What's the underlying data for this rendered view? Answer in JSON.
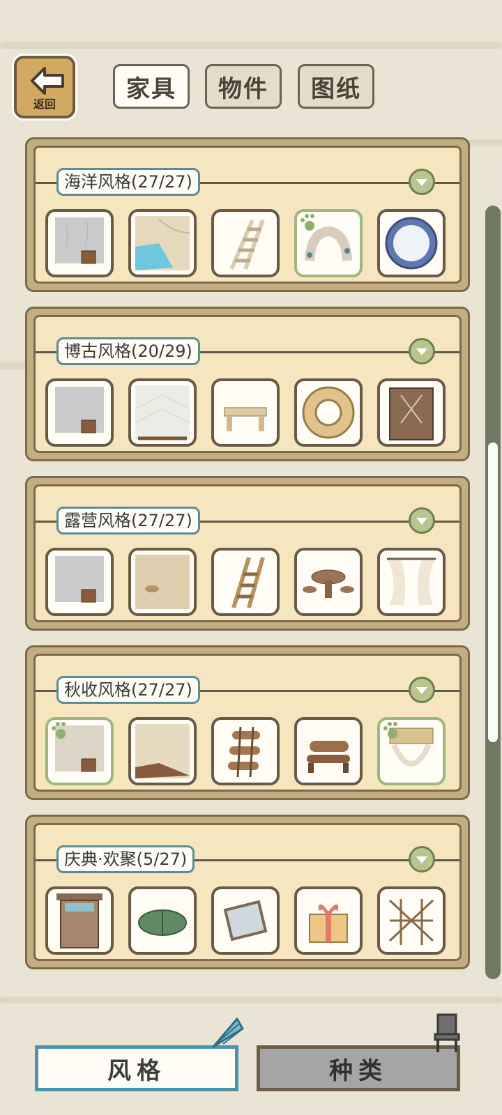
{
  "header": {
    "back_label": "返回",
    "tabs": [
      {
        "label": "家具",
        "active": true
      },
      {
        "label": "物件",
        "active": false
      },
      {
        "label": "图纸",
        "active": false
      }
    ]
  },
  "sections": [
    {
      "title": "海洋风格(27/27)",
      "items": [
        "wall-item",
        "pool-floor-item",
        "ladder-item",
        "rock-arch-item",
        "porthole-window-item"
      ],
      "selected": [
        3
      ]
    },
    {
      "title": "博古风格(20/29)",
      "items": [
        "wall-item",
        "tile-floor-item",
        "wooden-bench-item",
        "ring-rug-item",
        "lattice-door-item"
      ],
      "selected": []
    },
    {
      "title": "露营风格(27/27)",
      "items": [
        "wall-item",
        "sand-floor-item",
        "wooden-ladder-item",
        "stools-table-item",
        "curtain-window-item"
      ],
      "selected": []
    },
    {
      "title": "秋收风格(27/27)",
      "items": [
        "wall-item",
        "wood-floor-item",
        "log-ladder-item",
        "log-bench-item",
        "bamboo-window-item"
      ],
      "selected": [
        0,
        4
      ]
    },
    {
      "title": "庆典·欢聚(5/27)",
      "items": [
        "wooden-door-item",
        "green-bundle-item",
        "picture-frame-item",
        "gift-box-item",
        "bamboo-fence-item"
      ],
      "selected": []
    }
  ],
  "bottom_tabs": [
    {
      "label": "风格",
      "active": true,
      "icon": "seashell-icon"
    },
    {
      "label": "种类",
      "active": false,
      "icon": "chair-icon"
    }
  ],
  "colors": {
    "background": "#e9e4d4",
    "panel": "#f5e6bf",
    "panel_border": "#7c6a4c",
    "title_border": "#5e8c94",
    "selected_border": "#9cb87c",
    "active_tab_border": "#4d93ad"
  }
}
